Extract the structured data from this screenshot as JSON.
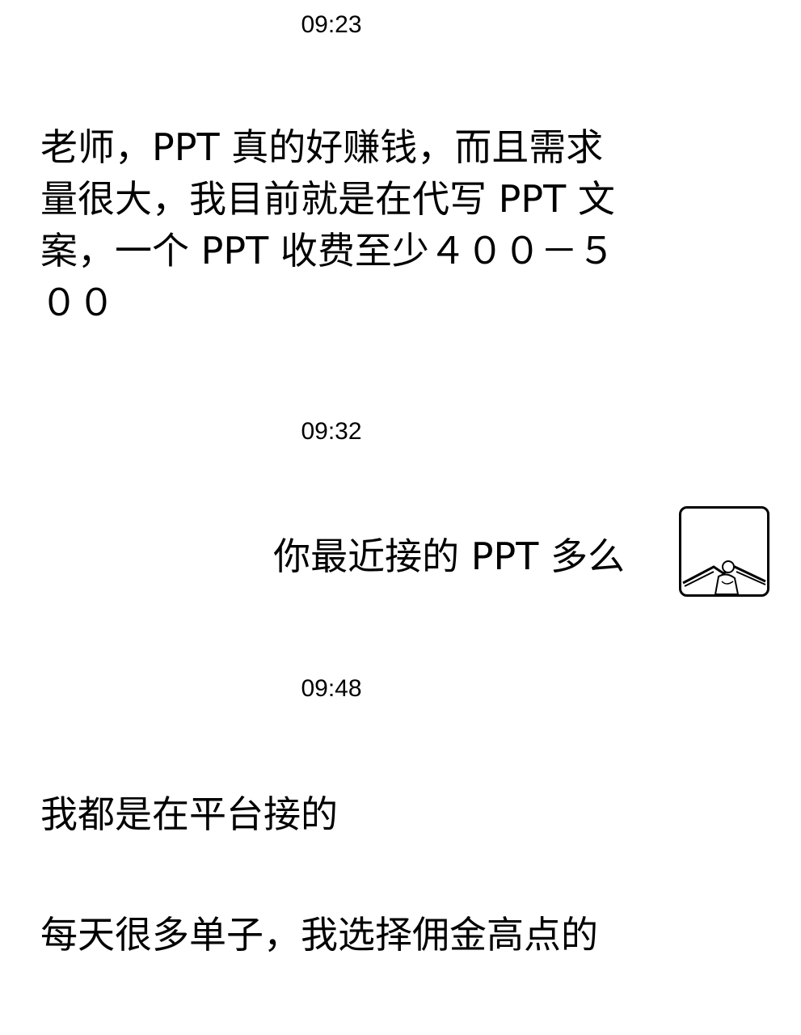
{
  "chat": {
    "timestamps": [
      "09:23",
      "09:32",
      "09:48"
    ],
    "messages": [
      {
        "side": "left",
        "text": "老师，PPT 真的好赚钱，而且需求量很大，我目前就是在代写 PPT 文案，一个 PPT 收费至少４００－５００"
      },
      {
        "side": "right",
        "text": "你最近接的 PPT 多么"
      },
      {
        "side": "left",
        "text": "我都是在平台接的"
      },
      {
        "side": "left",
        "text": "每天很多单子，我选择佣金高点的"
      }
    ]
  },
  "avatar": {
    "icon": "person-avatar-icon"
  }
}
